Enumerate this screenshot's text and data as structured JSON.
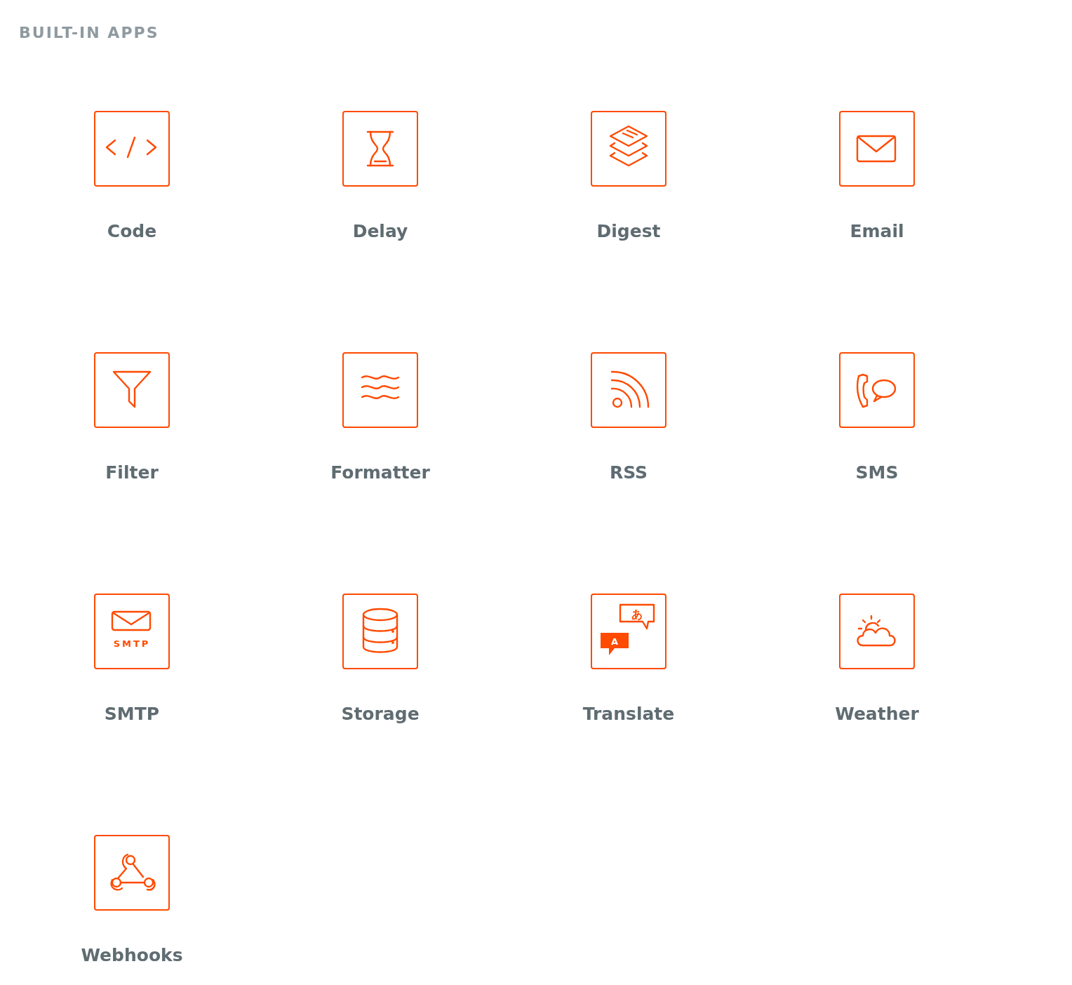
{
  "section": {
    "title": "BUILT-IN APPS"
  },
  "apps": [
    {
      "name": "Code",
      "kind": "code"
    },
    {
      "name": "Delay",
      "kind": "delay"
    },
    {
      "name": "Digest",
      "kind": "digest"
    },
    {
      "name": "Email",
      "kind": "email"
    },
    {
      "name": "Filter",
      "kind": "filter"
    },
    {
      "name": "Formatter",
      "kind": "formatter"
    },
    {
      "name": "RSS",
      "kind": "rss"
    },
    {
      "name": "SMS",
      "kind": "sms"
    },
    {
      "name": "SMTP",
      "kind": "smtp",
      "icon_text": [
        "SMTP"
      ]
    },
    {
      "name": "Storage",
      "kind": "storage"
    },
    {
      "name": "Translate",
      "kind": "translate",
      "icon_text": [
        "あ",
        "A"
      ]
    },
    {
      "name": "Weather",
      "kind": "weather"
    },
    {
      "name": "Webhooks",
      "kind": "webhooks"
    }
  ]
}
